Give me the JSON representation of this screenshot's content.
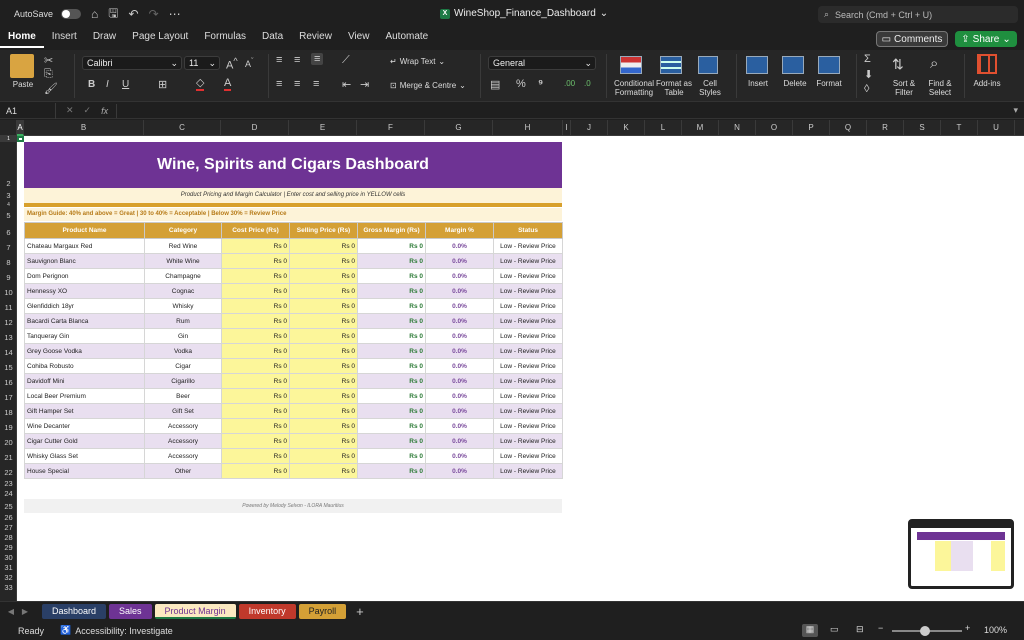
{
  "titlebar": {
    "autosave_label": "AutoSave",
    "workbook_title": "WineShop_Finance_Dashboard",
    "search_placeholder": "Search (Cmd + Ctrl + U)"
  },
  "menu": {
    "tabs": [
      "Home",
      "Insert",
      "Draw",
      "Page Layout",
      "Formulas",
      "Data",
      "Review",
      "View",
      "Automate"
    ],
    "active_tab": "Home",
    "comments_label": "Comments",
    "share_label": "Share"
  },
  "ribbon": {
    "paste_label": "Paste",
    "font_name": "Calibri",
    "font_size": "11",
    "wrap_text_label": "Wrap Text",
    "merge_label": "Merge & Centre",
    "number_format": "General",
    "conditional_formatting_label": "Conditional Formatting",
    "format_as_table_label": "Format as Table",
    "cell_styles_label": "Cell Styles",
    "insert_label": "Insert",
    "delete_label": "Delete",
    "format_label": "Format",
    "sort_filter_label": "Sort & Filter",
    "find_select_label": "Find & Select",
    "addins_label": "Add-ins"
  },
  "formula_bar": {
    "name_box": "A1",
    "fx_label": "fx",
    "content": ""
  },
  "columns": [
    "A",
    "B",
    "C",
    "D",
    "E",
    "F",
    "G",
    "H",
    "I",
    "J",
    "K",
    "L",
    "M",
    "N",
    "O",
    "P",
    "Q",
    "R",
    "S",
    "T",
    "U"
  ],
  "rows": [
    "1",
    "2",
    "3",
    "4",
    "5",
    "6",
    "7",
    "8",
    "9",
    "10",
    "11",
    "12",
    "13",
    "14",
    "15",
    "16",
    "17",
    "18",
    "19",
    "20",
    "21",
    "22",
    "23",
    "24",
    "25",
    "26",
    "27",
    "28",
    "29",
    "30",
    "31",
    "32",
    "33"
  ],
  "sheet": {
    "title": "Wine, Spirits and Cigars Dashboard",
    "subtitle": "Product Pricing and Margin Calculator  |  Enter cost and selling price in YELLOW cells",
    "margin_guide": "Margin Guide:  40% and above = Great   |   30 to 40% = Acceptable   |   Below 30% = Review Price",
    "headers": [
      "Product Name",
      "Category",
      "Cost Price (Rs)",
      "Selling Price (Rs)",
      "Gross Margin (Rs)",
      "Margin %",
      "Status"
    ],
    "products": [
      {
        "name": "Chateau Margaux Red",
        "category": "Red Wine",
        "cost": "Rs 0",
        "selling": "Rs 0",
        "gross": "Rs 0",
        "margin": "0.0%",
        "status": "Low - Review Price"
      },
      {
        "name": "Sauvignon Blanc",
        "category": "White Wine",
        "cost": "Rs 0",
        "selling": "Rs 0",
        "gross": "Rs 0",
        "margin": "0.0%",
        "status": "Low - Review Price"
      },
      {
        "name": "Dom Perignon",
        "category": "Champagne",
        "cost": "Rs 0",
        "selling": "Rs 0",
        "gross": "Rs 0",
        "margin": "0.0%",
        "status": "Low - Review Price"
      },
      {
        "name": "Hennessy XO",
        "category": "Cognac",
        "cost": "Rs 0",
        "selling": "Rs 0",
        "gross": "Rs 0",
        "margin": "0.0%",
        "status": "Low - Review Price"
      },
      {
        "name": "Glenfiddich 18yr",
        "category": "Whisky",
        "cost": "Rs 0",
        "selling": "Rs 0",
        "gross": "Rs 0",
        "margin": "0.0%",
        "status": "Low - Review Price"
      },
      {
        "name": "Bacardi Carta Blanca",
        "category": "Rum",
        "cost": "Rs 0",
        "selling": "Rs 0",
        "gross": "Rs 0",
        "margin": "0.0%",
        "status": "Low - Review Price"
      },
      {
        "name": "Tanqueray Gin",
        "category": "Gin",
        "cost": "Rs 0",
        "selling": "Rs 0",
        "gross": "Rs 0",
        "margin": "0.0%",
        "status": "Low - Review Price"
      },
      {
        "name": "Grey Goose Vodka",
        "category": "Vodka",
        "cost": "Rs 0",
        "selling": "Rs 0",
        "gross": "Rs 0",
        "margin": "0.0%",
        "status": "Low - Review Price"
      },
      {
        "name": "Cohiba Robusto",
        "category": "Cigar",
        "cost": "Rs 0",
        "selling": "Rs 0",
        "gross": "Rs 0",
        "margin": "0.0%",
        "status": "Low - Review Price"
      },
      {
        "name": "Davidoff Mini",
        "category": "Cigarillo",
        "cost": "Rs 0",
        "selling": "Rs 0",
        "gross": "Rs 0",
        "margin": "0.0%",
        "status": "Low - Review Price"
      },
      {
        "name": "Local Beer Premium",
        "category": "Beer",
        "cost": "Rs 0",
        "selling": "Rs 0",
        "gross": "Rs 0",
        "margin": "0.0%",
        "status": "Low - Review Price"
      },
      {
        "name": "Gift Hamper Set",
        "category": "Gift Set",
        "cost": "Rs 0",
        "selling": "Rs 0",
        "gross": "Rs 0",
        "margin": "0.0%",
        "status": "Low - Review Price"
      },
      {
        "name": "Wine Decanter",
        "category": "Accessory",
        "cost": "Rs 0",
        "selling": "Rs 0",
        "gross": "Rs 0",
        "margin": "0.0%",
        "status": "Low - Review Price"
      },
      {
        "name": "Cigar Cutter Gold",
        "category": "Accessory",
        "cost": "Rs 0",
        "selling": "Rs 0",
        "gross": "Rs 0",
        "margin": "0.0%",
        "status": "Low - Review Price"
      },
      {
        "name": "Whisky Glass Set",
        "category": "Accessory",
        "cost": "Rs 0",
        "selling": "Rs 0",
        "gross": "Rs 0",
        "margin": "0.0%",
        "status": "Low - Review Price"
      },
      {
        "name": "House Special",
        "category": "Other",
        "cost": "Rs 0",
        "selling": "Rs 0",
        "gross": "Rs 0",
        "margin": "0.0%",
        "status": "Low - Review Price"
      }
    ],
    "footer": "Powered by Melody Selvon  -  ILORA Mauritius"
  },
  "sheet_tabs": [
    {
      "label": "Dashboard",
      "color": "#2a3f66",
      "text": "#ffffff",
      "active": false
    },
    {
      "label": "Sales",
      "color": "#6e3394",
      "text": "#ffffff",
      "active": false
    },
    {
      "label": "Product Margin",
      "color": "#fbe9c1",
      "text": "#6e3394",
      "active": true
    },
    {
      "label": "Inventory",
      "color": "#c0392b",
      "text": "#ffffff",
      "active": false
    },
    {
      "label": "Payroll",
      "color": "#d4a036",
      "text": "#222222",
      "active": false
    }
  ],
  "statusbar": {
    "ready": "Ready",
    "accessibility": "Accessibility: Investigate",
    "zoom": "100%"
  },
  "colors": {
    "banner": "#6e3394",
    "header_gold": "#d4a036",
    "input_yellow": "#fcf69a",
    "alt_row": "#e9dff0",
    "share_green": "#1f8f3f"
  }
}
